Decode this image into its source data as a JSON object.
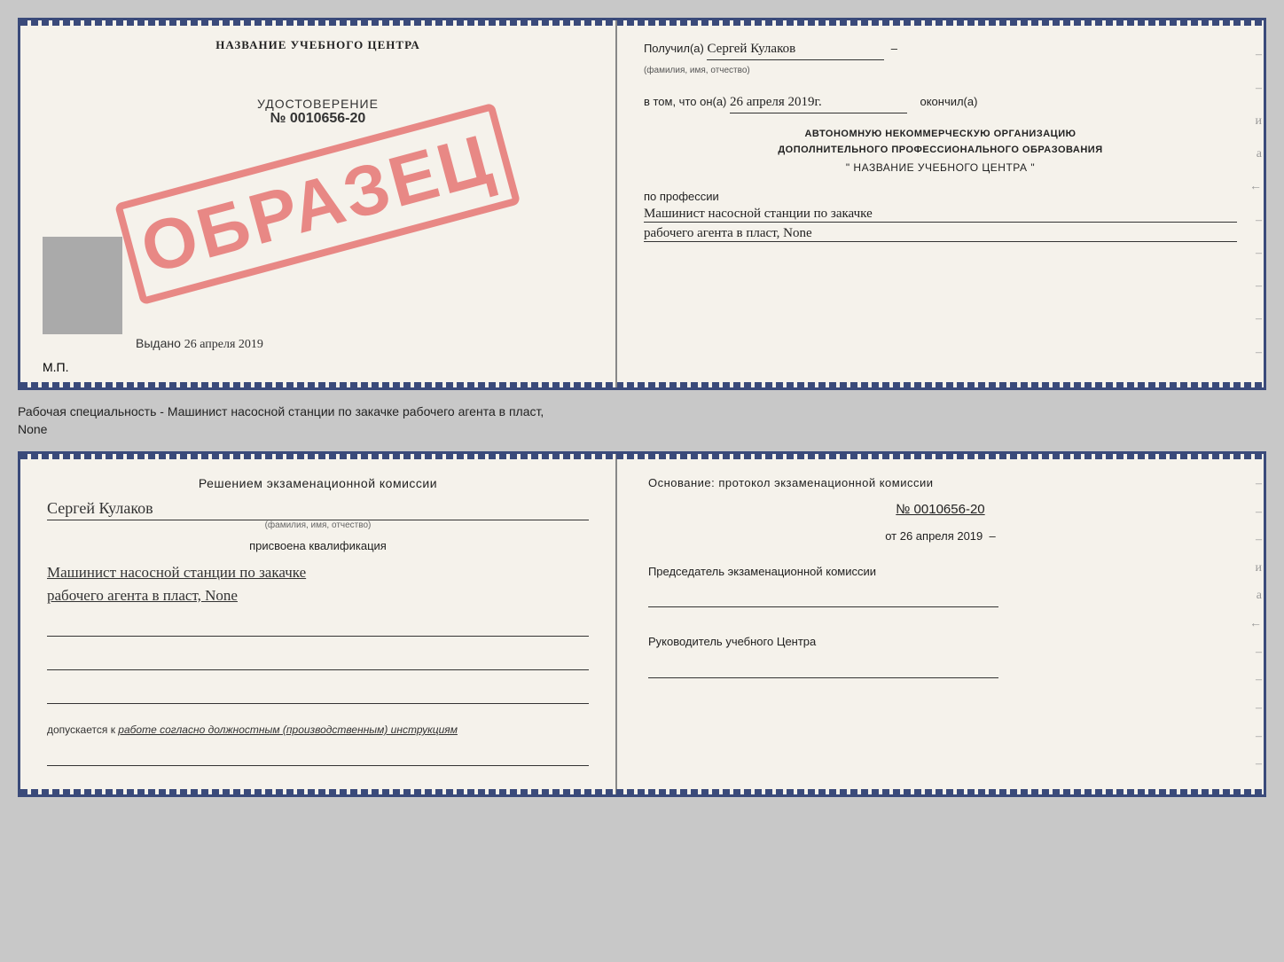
{
  "top_doc": {
    "left": {
      "center_title": "НАЗВАНИЕ УЧЕБНОГО ЦЕНТРА",
      "stamp_text": "ОБРАЗЕЦ",
      "udostoverenie_label": "УДОСТОВЕРЕНИЕ",
      "number": "№ 0010656-20",
      "vydano_prefix": "Выдано",
      "vydano_date": "26 апреля 2019",
      "mp_label": "М.П."
    },
    "right": {
      "poluchil_prefix": "Получил(а)",
      "poluchil_name": "Сергей Кулаков",
      "poluchil_sublabel": "(фамилия, имя, отчество)",
      "vtom_prefix": "в том, что он(а)",
      "vtom_date": "26 апреля 2019г.",
      "okonchil": "окончил(а)",
      "org_line1": "АВТОНОМНУЮ НЕКОММЕРЧЕСКУЮ ОРГАНИЗАЦИЮ",
      "org_line2": "ДОПОЛНИТЕЛЬНОГО ПРОФЕССИОНАЛЬНОГО ОБРАЗОВАНИЯ",
      "org_line3": "\"  НАЗВАНИЕ УЧЕБНОГО ЦЕНТРА  \"",
      "po_professii": "по профессии",
      "profession_line1": "Машинист насосной станции по закачке",
      "profession_line2": "рабочего агента в пласт, None"
    }
  },
  "between_caption": {
    "line1": "Рабочая специальность - Машинист насосной станции по закачке рабочего агента в пласт,",
    "line2": "None"
  },
  "bottom_doc": {
    "left": {
      "komissia_title": "Решением  экзаменационной  комиссии",
      "name": "Сергей Кулаков",
      "name_sublabel": "(фамилия, имя, отчество)",
      "prisvoena_label": "присвоена квалификация",
      "qualification_line1": "Машинист насосной станции по закачке",
      "qualification_line2": "рабочего агента в пласт, None",
      "dopuskaetsya_prefix": "допускается к",
      "dopuskaetsya_text": "работе согласно должностным (производственным) инструкциям"
    },
    "right": {
      "osnovanie_title": "Основание: протокол экзаменационной комиссии",
      "protocol_number": "№  0010656-20",
      "protocol_date_prefix": "от",
      "protocol_date": "26 апреля 2019",
      "predsedatel_title": "Председатель экзаменационной комиссии",
      "rukovoditel_title": "Руководитель учебного Центра"
    }
  }
}
